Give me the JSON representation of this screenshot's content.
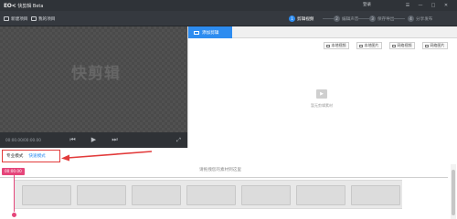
{
  "titlebar": {
    "logo": "EO<",
    "app_name": "快剪辑 Beta",
    "login": "登录",
    "icons": [
      "menu-icon",
      "minimize-icon",
      "maximize-icon",
      "close-icon"
    ]
  },
  "toolbar": {
    "new_project": "新建项目",
    "my_projects": "我的项目",
    "steps": [
      {
        "num": "1",
        "label": "剪辑视频"
      },
      {
        "num": "2",
        "label": "编辑声音"
      },
      {
        "num": "3",
        "label": "保存导出"
      },
      {
        "num": "4",
        "label": "分享发布"
      }
    ],
    "active_step": 0
  },
  "preview": {
    "watermark": "快剪辑",
    "timecode": "00:00.00/00:00.00",
    "icons": [
      "previous-icon",
      "play-icon",
      "next-icon",
      "fullscreen-icon"
    ]
  },
  "panel": {
    "tab_label": "添加剪辑",
    "add_buttons": [
      "本地视频",
      "本地图片",
      "网络视频",
      "网络图片"
    ],
    "empty_text": "暂无剪辑素材"
  },
  "mode": {
    "pro": "专业模式",
    "fast": "快速模式"
  },
  "timeline": {
    "hint": "请拖拽您的素材到这里",
    "playhead_time": "00:00.00"
  },
  "colors": {
    "accent": "#2d8cf0",
    "highlight_box": "#e23b3b",
    "playhead": "#e5457a",
    "titlebar_bg": "#2f3338"
  }
}
